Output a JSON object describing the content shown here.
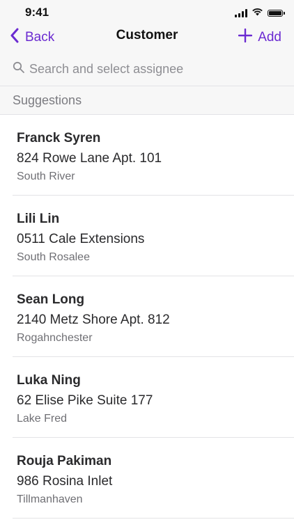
{
  "status_bar": {
    "time": "9:41"
  },
  "nav": {
    "back_label": "Back",
    "title": "Customer",
    "add_label": "Add",
    "accent_color": "#6b2bd1"
  },
  "search": {
    "placeholder": "Search and select assignee",
    "value": ""
  },
  "section": {
    "title": "Suggestions"
  },
  "customers": [
    {
      "name": "Franck Syren",
      "street": "824 Rowe Lane Apt. 101",
      "city": "South River"
    },
    {
      "name": "Lili Lin",
      "street": "0511 Cale Extensions",
      "city": "South Rosalee"
    },
    {
      "name": "Sean Long",
      "street": "2140 Metz Shore Apt. 812",
      "city": "Rogahnchester"
    },
    {
      "name": "Luka Ning",
      "street": "62 Elise Pike Suite 177",
      "city": "Lake Fred"
    },
    {
      "name": "Rouja Pakiman",
      "street": "986 Rosina Inlet",
      "city": "Tillmanhaven"
    }
  ],
  "icons": {
    "back": "chevron-left-icon",
    "add": "plus-icon",
    "search": "search-icon",
    "signal": "cellular-signal-icon",
    "wifi": "wifi-icon",
    "battery": "battery-icon"
  }
}
